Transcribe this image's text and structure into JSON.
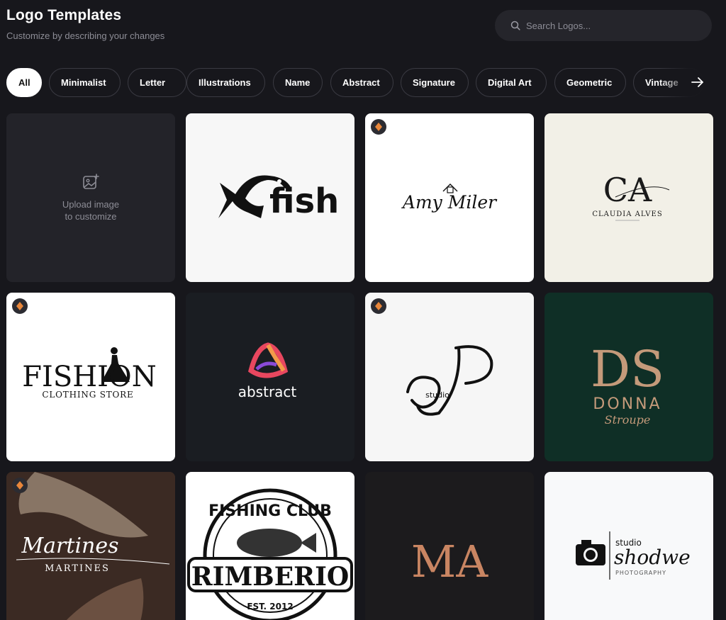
{
  "header": {
    "title": "Logo Templates",
    "subtitle": "Customize by describing your changes"
  },
  "search": {
    "placeholder": "Search Logos...",
    "value": ""
  },
  "filters": [
    {
      "label": "All",
      "active": true
    },
    {
      "label": "Minimalist",
      "active": false
    },
    {
      "label": "Letter",
      "active": false
    },
    {
      "label": "Illustrations",
      "active": false
    },
    {
      "label": "Name",
      "active": false
    },
    {
      "label": "Abstract",
      "active": false
    },
    {
      "label": "Signature",
      "active": false
    },
    {
      "label": "Digital Art",
      "active": false
    },
    {
      "label": "Geometric",
      "active": false
    },
    {
      "label": "Vintage",
      "active": false
    }
  ],
  "upload": {
    "line1": "Upload image",
    "line2": "to customize"
  },
  "cards": [
    {
      "logo_text": "fish",
      "premium": false
    },
    {
      "logo_text": "Amy Miler",
      "premium": true
    },
    {
      "logo_text": "CA",
      "logo_subtext": "CLAUDIA ALVES",
      "premium": false
    },
    {
      "logo_text": "FISHION",
      "logo_subtext": "CLOTHING STORE",
      "premium": true
    },
    {
      "logo_text": "abstract",
      "premium": false
    },
    {
      "logo_text": "P",
      "logo_subtext": "studio",
      "premium": true
    },
    {
      "logo_text": "DS",
      "logo_subtext": "DONNA",
      "logo_script": "Stroupe",
      "premium": false
    },
    {
      "logo_text": "Martines",
      "logo_subtext": "MARTINES",
      "premium": true
    },
    {
      "logo_text": "FISHING CLUB",
      "logo_subtext": "RIMBERIO",
      "logo_year": "EST. 2012",
      "premium": false
    },
    {
      "logo_text": "MA",
      "premium": false
    },
    {
      "logo_text": "shodwe",
      "logo_small": "studio",
      "logo_subtext": "PHOTOGRAPHY",
      "premium": false
    }
  ],
  "colors": {
    "background": "#17171c",
    "surface": "#25252b",
    "premium_badge": "#e8863a",
    "donna_green": "#0f2f26",
    "ma_copper": "#c98562"
  },
  "icons": [
    "search-icon",
    "arrow-right-icon",
    "image-upload-icon",
    "premium-diamond-icon"
  ]
}
